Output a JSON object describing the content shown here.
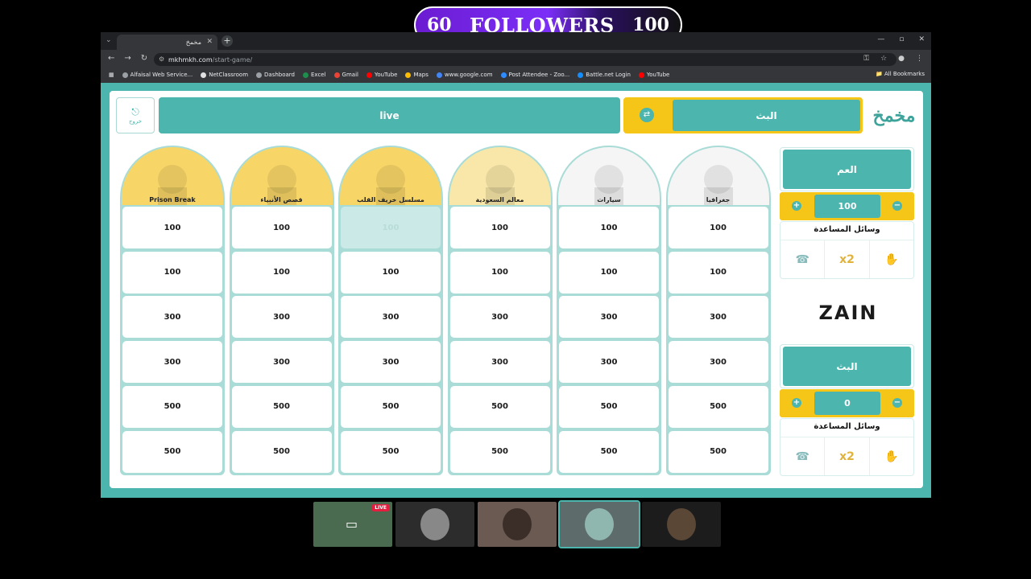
{
  "overlay": {
    "current": "60",
    "label": "FOLLOWERS",
    "goal": "100"
  },
  "browser": {
    "tab_title": "مخمخ",
    "url_host": "mkhmkh.com",
    "url_path": "/start-game/",
    "bookmarks": [
      {
        "label": "Alfaisal Web Service...",
        "color": "#9aa0a6"
      },
      {
        "label": "NetClassroom",
        "color": "#e0e0e0"
      },
      {
        "label": "Dashboard",
        "color": "#9aa0a6"
      },
      {
        "label": "Excel",
        "color": "#1d8e4c"
      },
      {
        "label": "Gmail",
        "color": "#ea4335"
      },
      {
        "label": "YouTube",
        "color": "#ff0000"
      },
      {
        "label": "Maps",
        "color": "#fbbc04"
      },
      {
        "label": "www.google.com",
        "color": "#4285f4"
      },
      {
        "label": "Post Attendee - Zoo...",
        "color": "#2d8cff"
      },
      {
        "label": "Battle.net Login",
        "color": "#148eff"
      },
      {
        "label": "YouTube",
        "color": "#ff0000"
      }
    ],
    "all_bookmarks": "All Bookmarks"
  },
  "header": {
    "exit_label": "خروج",
    "live_label": "live",
    "current_team": "البث",
    "logo_text": "مخمخ"
  },
  "categories": [
    {
      "name": "Prison Break",
      "bg": "#f8d567",
      "cells": [
        {
          "v": "100",
          "used": false
        },
        {
          "v": "100",
          "used": false
        },
        {
          "v": "300",
          "used": false
        },
        {
          "v": "300",
          "used": false
        },
        {
          "v": "500",
          "used": false
        },
        {
          "v": "500",
          "used": false
        }
      ]
    },
    {
      "name": "قصص الأنبياء",
      "bg": "#f8d567",
      "cells": [
        {
          "v": "100",
          "used": false
        },
        {
          "v": "100",
          "used": false
        },
        {
          "v": "300",
          "used": false
        },
        {
          "v": "300",
          "used": false
        },
        {
          "v": "500",
          "used": false
        },
        {
          "v": "500",
          "used": false
        }
      ]
    },
    {
      "name": "مسلسل خريف القلب",
      "bg": "#f8d567",
      "cells": [
        {
          "v": "100",
          "used": true
        },
        {
          "v": "100",
          "used": false
        },
        {
          "v": "300",
          "used": false
        },
        {
          "v": "300",
          "used": false
        },
        {
          "v": "500",
          "used": false
        },
        {
          "v": "500",
          "used": false
        }
      ]
    },
    {
      "name": "معالم السعودية",
      "bg": "#f8e7a8",
      "cells": [
        {
          "v": "100",
          "used": false
        },
        {
          "v": "100",
          "used": false
        },
        {
          "v": "300",
          "used": false
        },
        {
          "v": "300",
          "used": false
        },
        {
          "v": "500",
          "used": false
        },
        {
          "v": "500",
          "used": false
        }
      ]
    },
    {
      "name": "سيارات",
      "bg": "#f5f5f5",
      "cells": [
        {
          "v": "100",
          "used": false
        },
        {
          "v": "100",
          "used": false
        },
        {
          "v": "300",
          "used": false
        },
        {
          "v": "300",
          "used": false
        },
        {
          "v": "500",
          "used": false
        },
        {
          "v": "500",
          "used": false
        }
      ]
    },
    {
      "name": "جغرافيا",
      "bg": "#f5f5f5",
      "cells": [
        {
          "v": "100",
          "used": false
        },
        {
          "v": "100",
          "used": false
        },
        {
          "v": "300",
          "used": false
        },
        {
          "v": "300",
          "used": false
        },
        {
          "v": "500",
          "used": false
        },
        {
          "v": "500",
          "used": false
        }
      ]
    }
  ],
  "teams": [
    {
      "name": "العم",
      "score": "100",
      "aids_title": "وسائل المساعدة"
    },
    {
      "name": "البث",
      "score": "0",
      "aids_title": "وسائل المساعدة"
    }
  ],
  "aid_icons": [
    "call-friend-icon",
    "double-points-icon",
    "rest-icon"
  ],
  "aid_glyphs": [
    "☎",
    "x2",
    "✋"
  ],
  "sponsor": "ZAIN",
  "colors": {
    "teal": "#4cb5ad",
    "yellow": "#f5c518",
    "purple": "#7b2ff7"
  },
  "participants_live": "LIVE"
}
